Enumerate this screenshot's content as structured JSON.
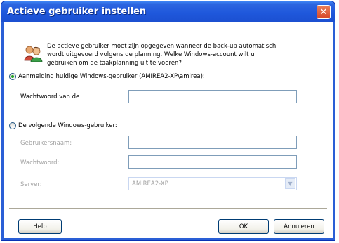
{
  "window": {
    "title": "Actieve gebruiker instellen",
    "close_symbol": "✕"
  },
  "intro": {
    "icon": "users-icon",
    "text": "De actieve gebruiker moet zijn opgegeven wanneer de back-up automatisch wordt uitgevoerd volgens de planning. Welke Windows-account wilt u gebruiken om de taakplanning uit te voeren?"
  },
  "current_user": {
    "selected": true,
    "label": "Aanmelding huidige Windows-gebruiker (AMIREA2-XP\\amirea):",
    "password_label": "Wachtwoord van de",
    "password_value": ""
  },
  "other_user": {
    "selected": false,
    "label": "De volgende Windows-gebruiker:",
    "username_label": "Gebruikersnaam:",
    "username_value": "",
    "password_label": "Wachtwoord:",
    "password_value": "",
    "server_label": "Server:",
    "server_value": "AMIREA2-XP"
  },
  "buttons": {
    "help": "Help",
    "ok": "OK",
    "cancel": "Annuleren"
  },
  "colors": {
    "title_bar": "#2a5fd6",
    "close_button": "#d6472a",
    "radio_dot": "#21a121",
    "disabled_text": "#a3a3a3"
  }
}
